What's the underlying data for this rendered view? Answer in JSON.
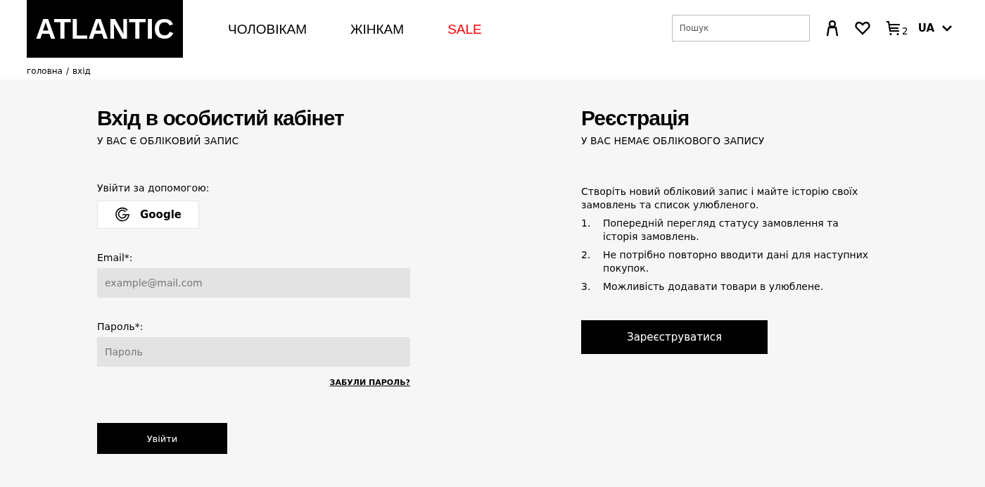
{
  "header": {
    "logo": "ATLANTIC",
    "nav": [
      {
        "label": "ЧОЛОВІКАМ",
        "highlight": false
      },
      {
        "label": "ЖІНКАМ",
        "highlight": false
      },
      {
        "label": "SALE",
        "highlight": true
      }
    ],
    "search": {
      "placeholder": "Пошук"
    },
    "cart_count": "2",
    "language": "UA"
  },
  "breadcrumb": [
    "головна",
    "/",
    "вхід"
  ],
  "login": {
    "title": "Вхід в особистий кабінет",
    "subtitle": "У ВАС Є ОБЛІКОВИЙ ЗАПИС",
    "social_label": "Увійти за допомогою:",
    "google": "Google",
    "fields": [
      {
        "label": "Email*:",
        "placeholder": "example@mail.com"
      },
      {
        "label": "Пароль*:",
        "placeholder": "Пароль"
      }
    ],
    "forgot": "ЗАБУЛИ ПАРОЛЬ?",
    "submit": "Увійти"
  },
  "register": {
    "title": "Реєстрація",
    "subtitle": "У ВАС НЕМАЄ ОБЛІКОВОГО ЗАПИСУ",
    "intro": "Створіть новий обліковий запис і майте історію своїх замовлень та список улюбленого.",
    "benefits": [
      {
        "number": "1.",
        "text": "Попередній перегляд статусу замовлення та історія замовлень."
      },
      {
        "number": "2.",
        "text": "Не потрібно повторно вводити дані для наступних покупок."
      },
      {
        "number": "3.",
        "text": "Можливість додавати товари в улюблене."
      }
    ],
    "submit": "Зареєструватися"
  }
}
